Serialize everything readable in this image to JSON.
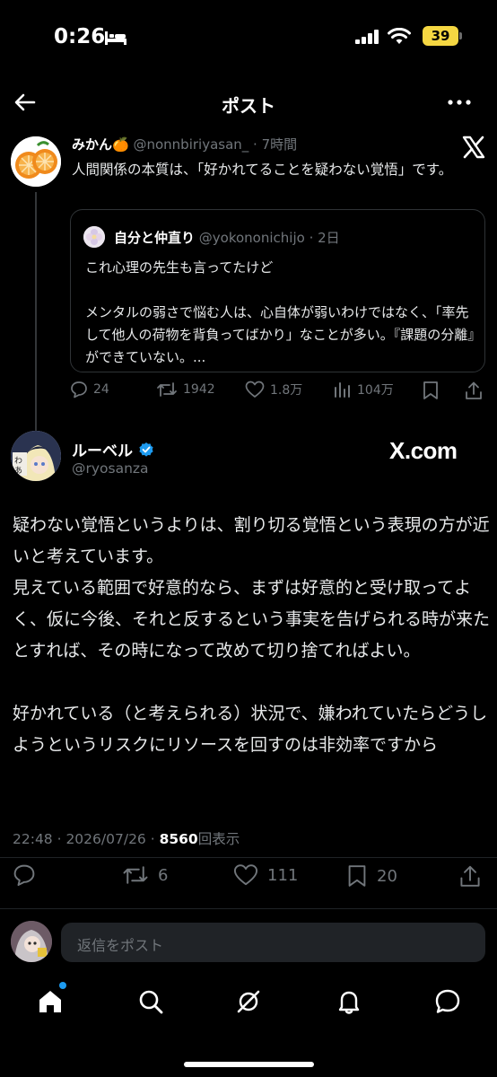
{
  "status_bar": {
    "time": "0:26",
    "battery": "39",
    "icons": [
      "bed-icon",
      "signal-icon",
      "wifi-icon",
      "battery-icon"
    ]
  },
  "header": {
    "title": "ポスト",
    "icons": [
      "back-arrow-icon",
      "more-icon"
    ]
  },
  "parent_post": {
    "name": "みかん🍊",
    "handle": "@nonnbiriyasan_ · 7時間",
    "text": "人間関係の本質は、「好かれてることを疑わない覚悟」です。",
    "quote": {
      "name": "自分と仲直り",
      "handle": "@yokononichijo · 2日",
      "text_line1": "これ心理の先生も言ってたけど",
      "text_line2": "メンタルの弱さで悩む人は、心自体が弱いわけではなく、「率先して他人の荷物を背負ってばかり」なことが多い。『課題の分離』ができていない。..."
    },
    "actions": {
      "replies": "24",
      "reposts": "1942",
      "likes": "1.8万",
      "views": "104万"
    }
  },
  "main_post": {
    "name": "ルーベル",
    "handle": "@ryosanza",
    "brand": "X.com",
    "text": "疑わない覚悟というよりは、割り切る覚悟という表現の方が近いと考えています。\n見えている範囲で好意的なら、まずは好意的と受け取ってよく、仮に今後、それと反するという事実を告げられる時が来たとすれば、その時になって改めて切り捨てればよい。\n\n好かれている（と考えられる）状況で、嫌われていたらどうしようというリスクにリソースを回すのは非効率ですから",
    "timestamp": "22:48 · 2026/07/26 · ",
    "views_count": "8560",
    "views_label": "回表示",
    "actions": {
      "replies": "",
      "reposts": "6",
      "likes": "111",
      "bookmarks": "20"
    }
  },
  "reply_bar": {
    "placeholder": "返信をポスト"
  },
  "bottom_nav": {
    "items": [
      "home-icon",
      "search-icon",
      "grok-icon",
      "notifications-icon",
      "messages-icon"
    ]
  },
  "colors": {
    "background": "#000000",
    "text": "#e7e9ea",
    "muted": "#71767b",
    "accent": "#1d9bf0",
    "battery": "#f5d742"
  }
}
